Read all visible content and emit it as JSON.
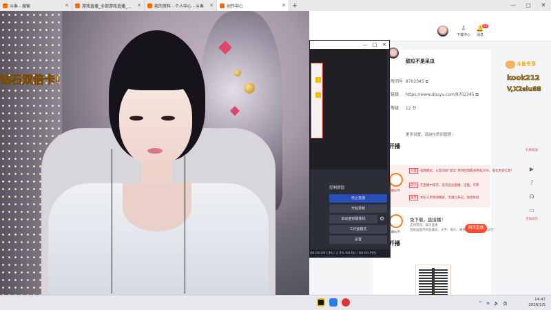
{
  "browser": {
    "tabs": [
      {
        "title": "斗鱼 - 搜索",
        "active": false
      },
      {
        "title": "游戏直播_全部游戏直播_斗鱼直播",
        "active": false
      },
      {
        "title": "我的资料 - 个人中心 - 斗鱼",
        "active": false
      },
      {
        "title": "创作中心",
        "active": true
      }
    ],
    "new_tab": "+",
    "controls": {
      "minimize": "—",
      "maximize": "□",
      "close": "✕"
    }
  },
  "stream": {
    "caption": "钻石双倍卡!"
  },
  "topbar": {
    "download_label": "下载中心",
    "message_label": "消息",
    "message_badge": "43"
  },
  "profile": {
    "name": "甜瓜不是呆瓜",
    "id": "8702345",
    "url": "https://www.douyu.com/8702345",
    "level": "12",
    "level_suffix": "分",
    "more_settings": "更多设置，请前往房间管理 ›",
    "label_room": "房间号",
    "label_link": "链接",
    "label_score": "等级"
  },
  "live_section": {
    "title": "开播",
    "rows": [
      {
        "tag": "功能",
        "text": "弱网模式，火友同屏“提高”用时回调最多降低20%，强化更多信息！"
      },
      {
        "tag": "提示",
        "text": "在直播中提示、首次启动直播，全面。可参"
      },
      {
        "tag": "推荐",
        "text": "本轮三月保持模式，无限包开启，加倍体验"
      }
    ],
    "badge_label": "直播伙伴"
  },
  "download": {
    "title": "免下载，直接播！",
    "desc": [
      "支持游戏，娱乐直播",
      "直接画面传到直播间，文字、照片、摄像头（含美颜）移动方"
    ],
    "button": "网页直播",
    "badge_label": "直播伙伴"
  },
  "mobile_section": {
    "title": "开播",
    "qr_caption": "斗鱼直播APP"
  },
  "sidebar_right": {
    "top_label": "礼物发放",
    "icons": [
      "play-icon",
      "help-icon",
      "headset-icon",
      "monitor-icon"
    ],
    "bottom_label": "活动日历"
  },
  "sticker": {
    "line1": "斗鱼专享",
    "line2": "kook212",
    "line3": "V,X2slu88"
  },
  "obs": {
    "dock_title": "控制按钮",
    "buttons": [
      "停止直播",
      "开始录制",
      "启动虚拟摄像机",
      "工作室模式",
      "设置"
    ],
    "status": "00:00:00   CPU: 2.3%   60.00 / 60.00 FPS"
  },
  "taskbar": {
    "lang": "英",
    "time": "14:47",
    "date": "2026/2/5"
  },
  "colors": {
    "accent": "#ff4a2e",
    "obs_primary": "#284cb8",
    "level_green": "#3a8a1e"
  }
}
